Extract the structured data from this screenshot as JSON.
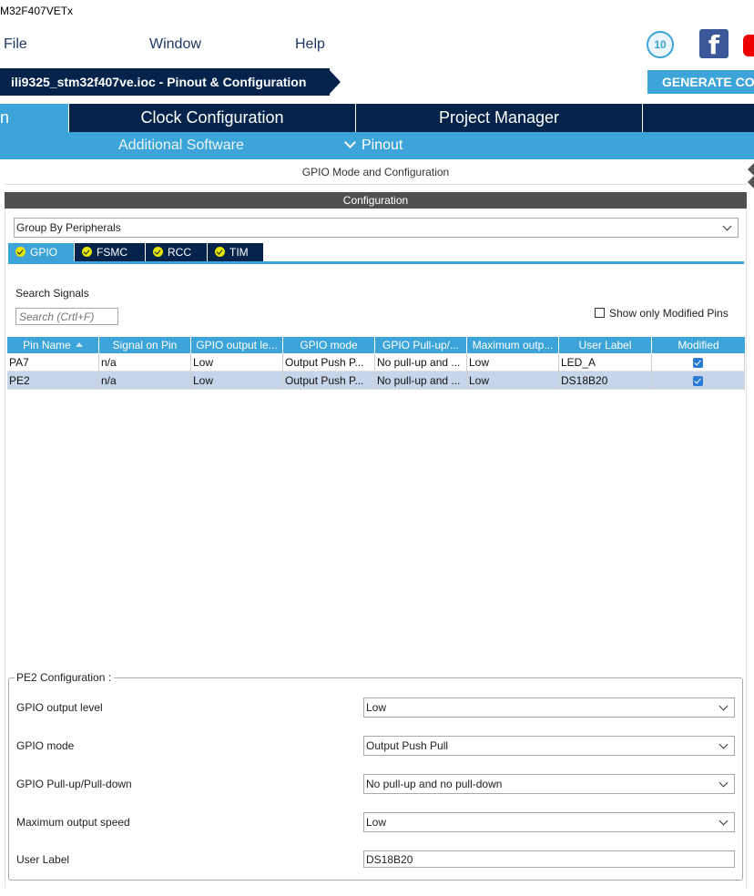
{
  "window": {
    "title": "M32F407VETx"
  },
  "menu": {
    "file": "File",
    "window": "Window",
    "help": "Help"
  },
  "badge": {
    "text": "10"
  },
  "social": {
    "facebook_glyph": "f"
  },
  "breadcrumb": {
    "label": "ili9325_stm32f407ve.ioc - Pinout & Configuration"
  },
  "generate": {
    "label": "GENERATE CODE"
  },
  "top_tabs": {
    "pinout": "n",
    "clock": "Clock Configuration",
    "project": "Project Manager",
    "tools": ""
  },
  "sub_tabs": {
    "additional": "Additional Software",
    "pinout": "Pinout"
  },
  "mode_panel": {
    "title": "GPIO Mode and Configuration"
  },
  "config": {
    "header": "Configuration",
    "group_by": "Group By Peripherals",
    "periph_tabs": [
      "GPIO",
      "FSMC",
      "RCC",
      "TIM"
    ],
    "search_label": "Search Signals",
    "search_placeholder": "Search (Crtl+F)",
    "show_modified": "Show only Modified Pins",
    "columns": [
      "Pin Name",
      "Signal on Pin",
      "GPIO output le...",
      "GPIO mode",
      "GPIO Pull-up/...",
      "Maximum outp...",
      "User Label",
      "Modified"
    ],
    "rows": [
      {
        "pin": "PA7",
        "signal": "n/a",
        "output": "Low",
        "mode": "Output Push P...",
        "pull": "No pull-up and ...",
        "speed": "Low",
        "label": "LED_A",
        "modified": true
      },
      {
        "pin": "PE2",
        "signal": "n/a",
        "output": "Low",
        "mode": "Output Push P...",
        "pull": "No pull-up and ...",
        "speed": "Low",
        "label": "DS18B20",
        "modified": true
      }
    ]
  },
  "pin_config": {
    "legend": "PE2 Configuration :",
    "output_level_label": "GPIO output level",
    "output_level_value": "Low",
    "mode_label": "GPIO mode",
    "mode_value": "Output Push Pull",
    "pull_label": "GPIO Pull-up/Pull-down",
    "pull_value": "No pull-up and no pull-down",
    "speed_label": "Maximum output speed",
    "speed_value": "Low",
    "user_label_label": "User Label",
    "user_label_value": "DS18B20"
  },
  "colors": {
    "navy": "#03234b",
    "accent": "#3ca4d8",
    "selected_row": "#c6d5ea",
    "header_gray": "#505050"
  }
}
